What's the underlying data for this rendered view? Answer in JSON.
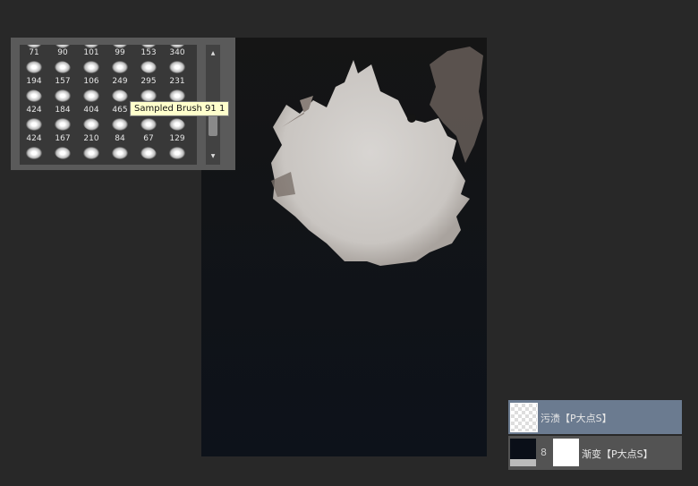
{
  "brush_panel": {
    "rows": [
      [
        "71",
        "90",
        "101",
        "99",
        "153",
        "340"
      ],
      [
        "194",
        "157",
        "106",
        "249",
        "295",
        "231"
      ],
      [
        "424",
        "184",
        "404",
        "465",
        "",
        ""
      ],
      [
        "424",
        "167",
        "210",
        "84",
        "67",
        "129"
      ]
    ],
    "tooltip": "Sampled Brush 91 1",
    "scroll_up_icon": "triangle-up",
    "scroll_down_icon": "triangle-down"
  },
  "layers": [
    {
      "name": "污渍【P大点S】",
      "selected": true,
      "thumbnail": "transparent-checker"
    },
    {
      "name": "渐变【P大点S】",
      "selected": false,
      "thumbnail": "dark-gradient",
      "mask": "white",
      "link_icon": "chain-link"
    }
  ],
  "colors": {
    "selected_layer": "#6b7b90",
    "layer_bg": "#535353",
    "background": "#282828",
    "tooltip": "#ffffcc"
  }
}
